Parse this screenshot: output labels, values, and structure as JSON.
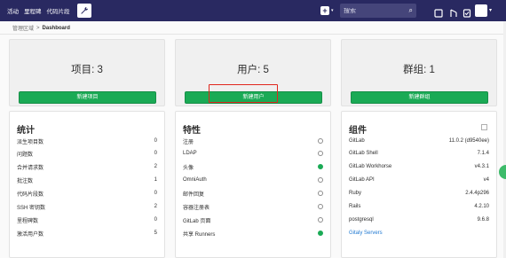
{
  "nav": {
    "links": [
      "活动",
      "里程碑",
      "代码片段"
    ],
    "add_label": "+",
    "search_placeholder": "搜索"
  },
  "breadcrumb": {
    "root": "管理区域",
    "separator": ">",
    "current": "Dashboard"
  },
  "stats": [
    {
      "title": "项目: 3",
      "button": "新建项目"
    },
    {
      "title": "用户: 5",
      "button": "新建用户"
    },
    {
      "title": "群组: 1",
      "button": "新建群组"
    }
  ],
  "statistics": {
    "title": "统计",
    "rows": [
      {
        "label": "派生项目数",
        "value": "0"
      },
      {
        "label": "问题数",
        "value": "0"
      },
      {
        "label": "合并请求数",
        "value": "2"
      },
      {
        "label": "批注数",
        "value": "1"
      },
      {
        "label": "代码片段数",
        "value": "0"
      },
      {
        "label": "SSH 密钥数",
        "value": "2"
      },
      {
        "label": "里程碑数",
        "value": "0"
      },
      {
        "label": "激活用户数",
        "value": "5"
      }
    ]
  },
  "features": {
    "title": "特性",
    "rows": [
      {
        "label": "注册",
        "enabled": false
      },
      {
        "label": "LDAP",
        "enabled": false
      },
      {
        "label": "头像",
        "enabled": true
      },
      {
        "label": "OmniAuth",
        "enabled": false
      },
      {
        "label": "邮件回复",
        "enabled": false
      },
      {
        "label": "容器注册表",
        "enabled": false
      },
      {
        "label": "GitLab 页面",
        "enabled": false
      },
      {
        "label": "共享 Runners",
        "enabled": true
      }
    ]
  },
  "components": {
    "title": "组件",
    "rows": [
      {
        "label": "GitLab",
        "value": "11.0.2 (d9540ee)"
      },
      {
        "label": "GitLab Shell",
        "value": "7.1.4"
      },
      {
        "label": "GitLab Workhorse",
        "value": "v4.3.1"
      },
      {
        "label": "GitLab API",
        "value": "v4"
      },
      {
        "label": "Ruby",
        "value": "2.4.4p296"
      },
      {
        "label": "Rails",
        "value": "4.2.10"
      },
      {
        "label": "postgresql",
        "value": "9.6.8"
      }
    ],
    "link": "Gitaly Servers"
  },
  "colors": {
    "navbar": "#292961",
    "green": "#1aaa55",
    "highlight": "#e0261d",
    "link": "#1f78d1"
  }
}
